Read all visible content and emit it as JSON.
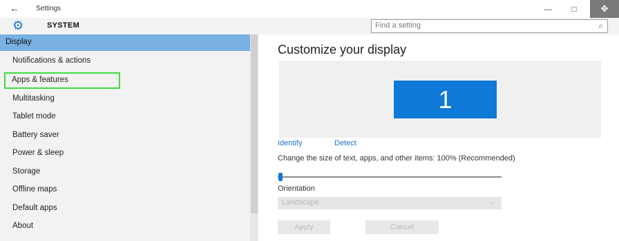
{
  "window": {
    "back_icon": "←",
    "title": "Settings",
    "minimize_icon": "—",
    "maximize_icon": "□",
    "extra_icon": "✥"
  },
  "header": {
    "gear_icon": "⚙",
    "section": "SYSTEM",
    "search_placeholder": "Find a setting",
    "search_icon": "⌕"
  },
  "sidebar": {
    "items": [
      {
        "label": "Display"
      },
      {
        "label": "Notifications & actions"
      },
      {
        "label": "Apps & features"
      },
      {
        "label": "Multitasking"
      },
      {
        "label": "Tablet mode"
      },
      {
        "label": "Battery saver"
      },
      {
        "label": "Power & sleep"
      },
      {
        "label": "Storage"
      },
      {
        "label": "Offline maps"
      },
      {
        "label": "Default apps"
      },
      {
        "label": "About"
      }
    ]
  },
  "main": {
    "heading": "Customize your display",
    "monitor_number": "1",
    "identify_link": "Identify",
    "detect_link": "Detect",
    "scale_label": "Change the size of text, apps, and other items: 100% (Recommended)",
    "scale_value_percent": 100,
    "orientation_label": "Orientation",
    "orientation_value": "Landscape",
    "dropdown_chevron": "⌄",
    "apply_button": "Apply",
    "cancel_button": "Cancel"
  },
  "colors": {
    "accent": "#0e79d6",
    "selected_item": "#78b1e2",
    "highlight_box": "#3ddc3d"
  }
}
